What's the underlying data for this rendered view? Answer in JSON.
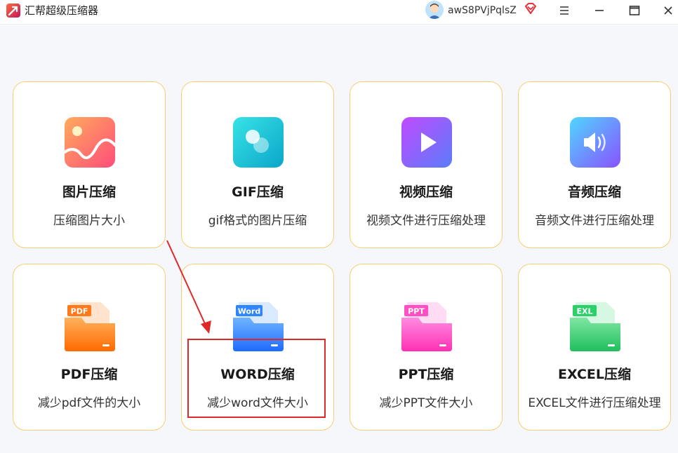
{
  "app": {
    "title": "汇帮超级压缩器"
  },
  "user": {
    "name": "awS8PVjPqlsZ"
  },
  "cards": [
    {
      "title": "图片压缩",
      "desc": "压缩图片大小",
      "icon": "image-icon"
    },
    {
      "title": "GIF压缩",
      "desc": "gif格式的图片压缩",
      "icon": "gif-icon"
    },
    {
      "title": "视频压缩",
      "desc": "视频文件进行压缩处理",
      "icon": "video-play-icon"
    },
    {
      "title": "音频压缩",
      "desc": "音频文件进行压缩处理",
      "icon": "speaker-icon"
    },
    {
      "title": "PDF压缩",
      "desc": "减少pdf文件的大小",
      "icon": "pdf-folder-icon",
      "badge": "PDF"
    },
    {
      "title": "WORD压缩",
      "desc": "减少word文件大小",
      "icon": "word-folder-icon",
      "badge": "Word"
    },
    {
      "title": "PPT压缩",
      "desc": "减少PPT文件大小",
      "icon": "ppt-folder-icon",
      "badge": "PPT"
    },
    {
      "title": "EXCEL压缩",
      "desc": "EXCEL文件进行压缩处理",
      "icon": "excel-folder-icon",
      "badge": "EXL"
    }
  ],
  "colors": {
    "card_border": "#f6cf74",
    "annotation": "#e02828",
    "image_icon": "#ff6f6f",
    "gif_icon": "#14c3d6",
    "video_icon": "#8b5cf6",
    "audio_icon": "#7c83ff",
    "pdf_icon": "#ff7a1a",
    "word_icon": "#2f86ff",
    "ppt_icon": "#ff4fc3",
    "excel_icon": "#2ccf6a"
  }
}
